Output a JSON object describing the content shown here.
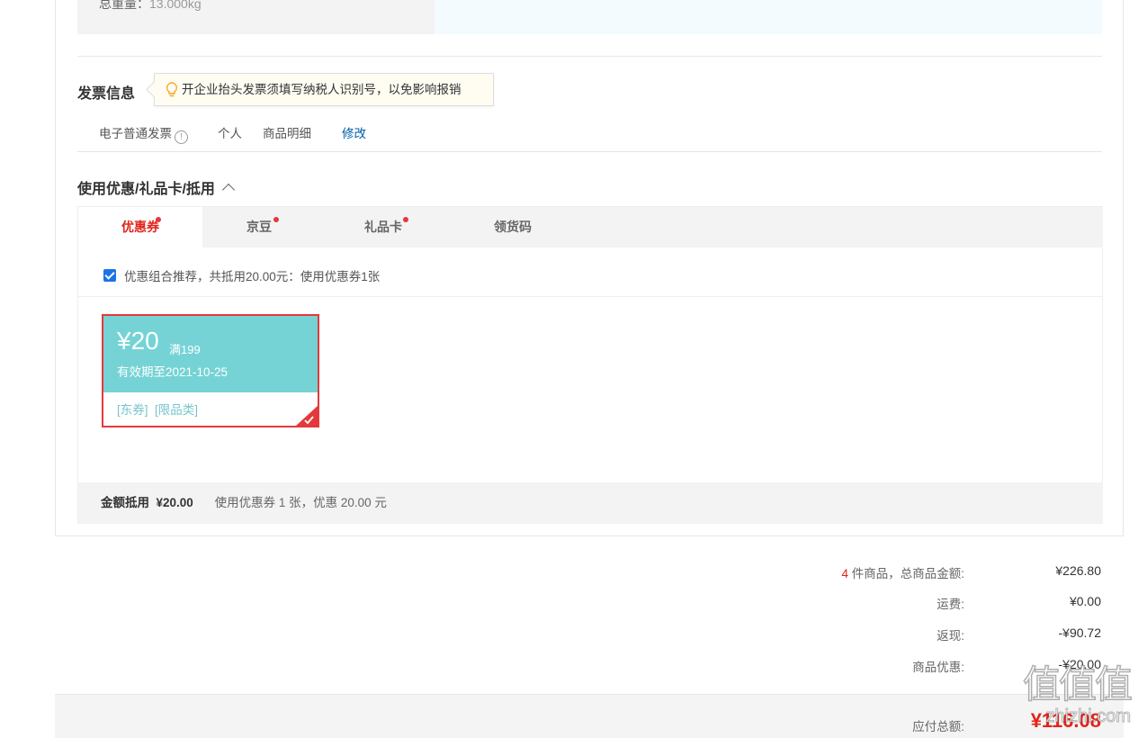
{
  "weight": {
    "label": "总重量：",
    "value": "13.000kg"
  },
  "invoice": {
    "title": "发票信息",
    "tip": "开企业抬头发票须填写纳税人识别号，以免影响报销",
    "type": "电子普通发票",
    "info_icon": "!",
    "holder": "个人",
    "content": "商品明细",
    "edit": "修改"
  },
  "discount": {
    "title": "使用优惠/礼品卡/抵用",
    "tabs": [
      {
        "label": "优惠券",
        "dot": true
      },
      {
        "label": "京豆",
        "dot": true
      },
      {
        "label": "礼品卡",
        "dot": true
      },
      {
        "label": "领货码",
        "dot": false
      }
    ],
    "recommend_text": "优惠组合推荐，共抵用20.00元：使用优惠券1张",
    "recommend_checked": true,
    "coupon": {
      "amount": "¥20",
      "condition": "满199",
      "expire": "有效期至2021-10-25",
      "tags": "[东券]  [限品类]",
      "selected": true
    },
    "total_label": "金额抵用",
    "total_value": "¥20.00",
    "total_desc": "使用优惠券 1 张，优惠 20.00 元"
  },
  "summary": {
    "count": "4",
    "count_label": " 件商品，总商品金额:",
    "goods_total": "¥226.80",
    "shipping_label": "运费:",
    "shipping": "¥0.00",
    "cashback_label": "返现:",
    "cashback": "-¥90.72",
    "discount_label": "商品优惠:",
    "discount": "-¥20.00",
    "pay_label": "应付总额:",
    "pay_total": "¥116.08"
  },
  "watermark": {
    "text": "值值值",
    "site": "zhizhi.com"
  },
  "colors": {
    "accent": "#e2231a",
    "coupon": "#75d3d5",
    "link": "#005ea7"
  }
}
